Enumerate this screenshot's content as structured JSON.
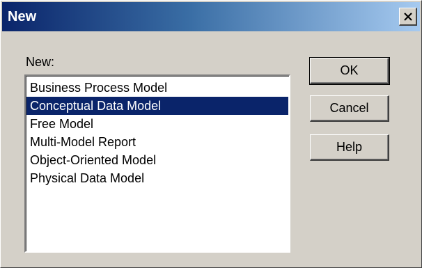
{
  "window": {
    "title": "New",
    "close_icon": "close-icon"
  },
  "list": {
    "label": "New:",
    "items": [
      "Business Process Model",
      "Conceptual Data Model",
      "Free Model",
      "Multi-Model Report",
      "Object-Oriented Model",
      "Physical Data Model"
    ],
    "selected": "Conceptual Data Model"
  },
  "buttons": {
    "ok": "OK",
    "cancel": "Cancel",
    "help": "Help"
  },
  "colors": {
    "selection": "#0a246a",
    "title_gradient_start": "#0a246a",
    "title_gradient_end": "#a6caf0",
    "dialog_background": "#d4d0c8"
  }
}
